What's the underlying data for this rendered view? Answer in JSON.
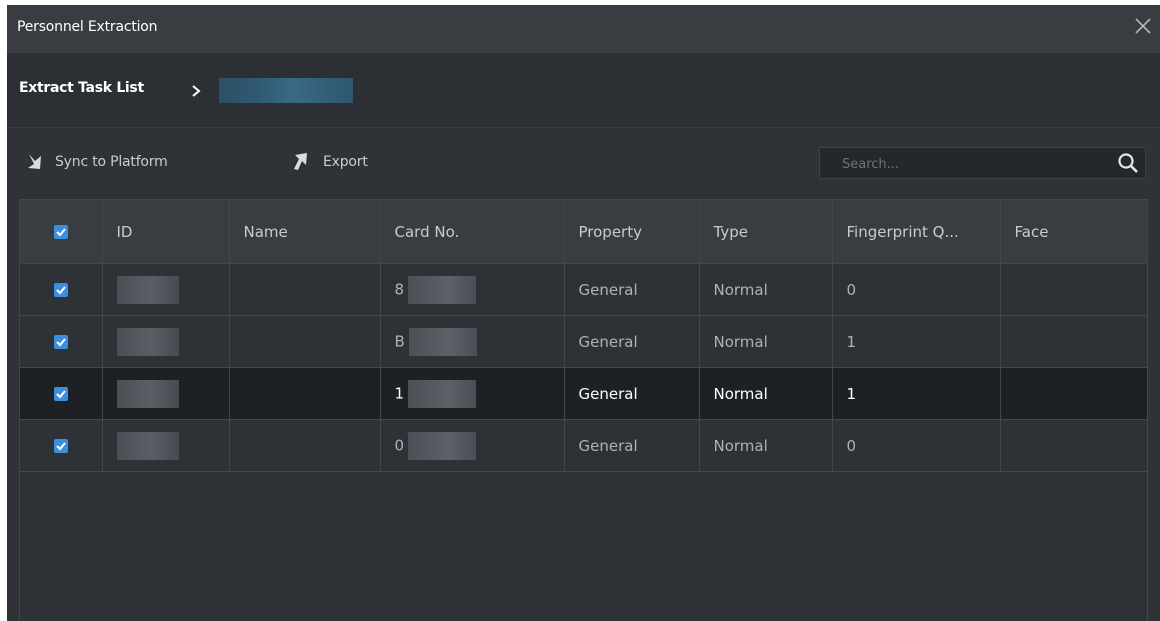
{
  "dialog": {
    "title": "Personnel Extraction"
  },
  "breadcrumb": {
    "root": "Extract Task List"
  },
  "toolbar": {
    "sync_label": "Sync to Platform",
    "export_label": "Export"
  },
  "search": {
    "placeholder": "Search..."
  },
  "table": {
    "columns": [
      "ID",
      "Name",
      "Card No.",
      "Property",
      "Type",
      "Fingerprint Q...",
      "Face"
    ],
    "rows": [
      {
        "id": "",
        "name": "",
        "card": "8",
        "property": "General",
        "type": "Normal",
        "fingerprint": "0",
        "face": ""
      },
      {
        "id": "",
        "name": "",
        "card": "B",
        "property": "General",
        "type": "Normal",
        "fingerprint": "1",
        "face": ""
      },
      {
        "id": "",
        "name": "",
        "card": "1",
        "property": "General",
        "type": "Normal",
        "fingerprint": "1",
        "face": "",
        "selected": true
      },
      {
        "id": "",
        "name": "",
        "card": "0",
        "property": "General",
        "type": "Normal",
        "fingerprint": "0",
        "face": ""
      }
    ]
  },
  "colors": {
    "accent": "#3c8fe0",
    "background": "#2f3237",
    "highlight_row": "#1e2124"
  },
  "icons": [
    "close-icon",
    "chevron-right-icon",
    "sync-icon",
    "export-icon",
    "search-icon",
    "checkbox-checked-icon"
  ]
}
